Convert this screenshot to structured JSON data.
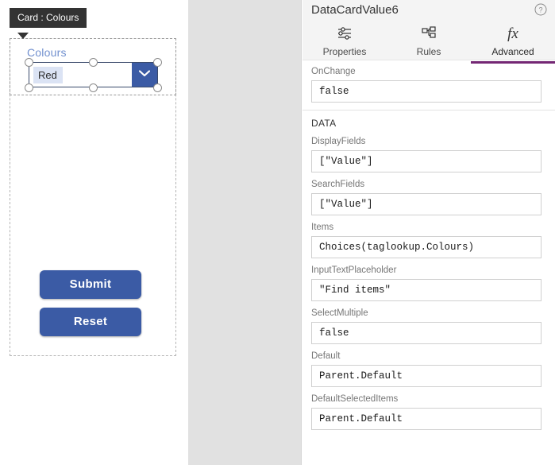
{
  "canvas": {
    "tooltip": "Card : Colours",
    "field_label": "Colours",
    "combo": {
      "selected_value": "Red",
      "dropdown_icon": "chevron-down-icon"
    },
    "buttons": [
      {
        "label": "Submit",
        "name": "submit-button"
      },
      {
        "label": "Reset",
        "name": "reset-button"
      }
    ]
  },
  "panel": {
    "title": "DataCardValue6",
    "help_icon": "question-circle-icon",
    "tabs": [
      {
        "label": "Properties",
        "icon": "sliders-icon",
        "active": false
      },
      {
        "label": "Rules",
        "icon": "hierarchy-icon",
        "active": false
      },
      {
        "label": "Advanced",
        "icon": "fx-icon",
        "active": true
      }
    ],
    "top_properties": [
      {
        "label": "OnChange",
        "value": "false"
      }
    ],
    "data_section": {
      "title": "DATA",
      "properties": [
        {
          "label": "DisplayFields",
          "value": "[\"Value\"]"
        },
        {
          "label": "SearchFields",
          "value": "[\"Value\"]"
        },
        {
          "label": "Items",
          "value": "Choices(taglookup.Colours)"
        },
        {
          "label": "InputTextPlaceholder",
          "value": "\"Find items\""
        },
        {
          "label": "SelectMultiple",
          "value": "false"
        },
        {
          "label": "Default",
          "value": "Parent.Default"
        },
        {
          "label": "DefaultSelectedItems",
          "value": "Parent.Default"
        }
      ]
    }
  },
  "colors": {
    "accent_purple": "#742774",
    "control_blue": "#3b5ba5",
    "label_blue": "#7190cf",
    "chip_blue": "#dbe3f4",
    "gutter_gray": "#e1e1e1"
  }
}
